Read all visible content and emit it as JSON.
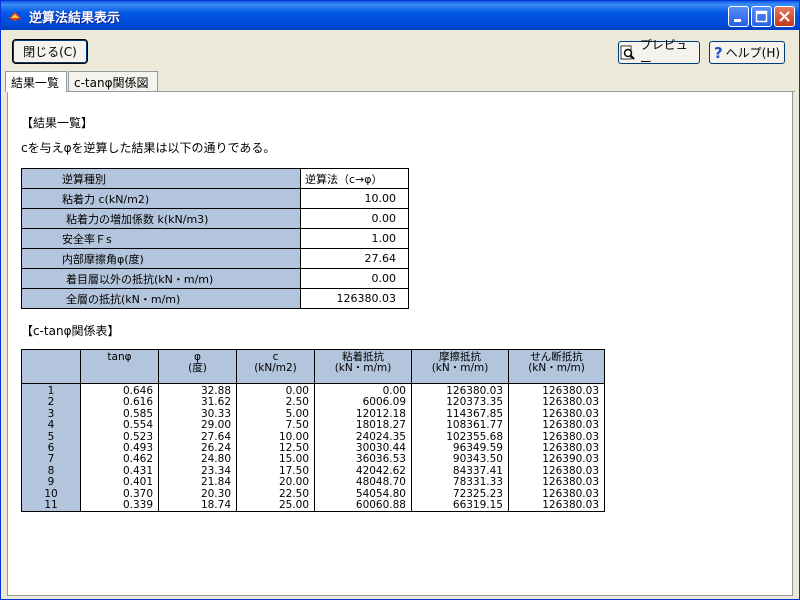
{
  "window": {
    "title": "逆算法結果表示"
  },
  "toolbar": {
    "close_label": "閉じる(C)",
    "preview_label": "プレビュー",
    "help_label": "ヘルプ(H)"
  },
  "tabs": [
    {
      "label": "結果一覧"
    },
    {
      "label": "c-tanφ関係図"
    }
  ],
  "summary": {
    "heading": "【結果一覧】",
    "description": "cを与えφを逆算した結果は以下の通りである。",
    "rows": [
      {
        "label": "逆算種別",
        "value": "逆算法（c→φ）"
      },
      {
        "label": "粘着力 c(kN/m2)",
        "value": "10.00"
      },
      {
        "label": "粘着力の増加係数 k(kN/m3)",
        "value": "0.00"
      },
      {
        "label": "安全率Ｆs",
        "value": "1.00"
      },
      {
        "label": "内部摩擦角φ(度)",
        "value": "27.64"
      },
      {
        "label": "着目層以外の抵抗(kN・m/m)",
        "value": "0.00"
      },
      {
        "label": "全層の抵抗(kN・m/m)",
        "value": "126380.03"
      }
    ]
  },
  "relation": {
    "heading": "【c-tanφ関係表】",
    "columns": [
      {
        "line1": "",
        "line2": ""
      },
      {
        "line1": "tanφ",
        "line2": ""
      },
      {
        "line1": "φ",
        "line2": "(度)"
      },
      {
        "line1": "c",
        "line2": "(kN/m2)"
      },
      {
        "line1": "粘着抵抗",
        "line2": "(kN・m/m)"
      },
      {
        "line1": "摩擦抵抗",
        "line2": "(kN・m/m)"
      },
      {
        "line1": "せん断抵抗",
        "line2": "(kN・m/m)"
      }
    ],
    "rows": [
      [
        "1",
        "0.646",
        "32.88",
        "0.00",
        "0.00",
        "126380.03",
        "126380.03"
      ],
      [
        "2",
        "0.616",
        "31.62",
        "2.50",
        "6006.09",
        "120373.35",
        "126380.03"
      ],
      [
        "3",
        "0.585",
        "30.33",
        "5.00",
        "12012.18",
        "114367.85",
        "126380.03"
      ],
      [
        "4",
        "0.554",
        "29.00",
        "7.50",
        "18018.27",
        "108361.77",
        "126380.03"
      ],
      [
        "5",
        "0.523",
        "27.64",
        "10.00",
        "24024.35",
        "102355.68",
        "126380.03"
      ],
      [
        "6",
        "0.493",
        "26.24",
        "12.50",
        "30030.44",
        "96349.59",
        "126380.03"
      ],
      [
        "7",
        "0.462",
        "24.80",
        "15.00",
        "36036.53",
        "90343.50",
        "126390.03"
      ],
      [
        "8",
        "0.431",
        "23.34",
        "17.50",
        "42042.62",
        "84337.41",
        "126380.03"
      ],
      [
        "9",
        "0.401",
        "21.84",
        "20.00",
        "48048.70",
        "78331.33",
        "126380.03"
      ],
      [
        "10",
        "0.370",
        "20.30",
        "22.50",
        "54054.80",
        "72325.23",
        "126380.03"
      ],
      [
        "11",
        "0.339",
        "18.74",
        "25.00",
        "60060.88",
        "66319.15",
        "126380.03"
      ]
    ]
  }
}
